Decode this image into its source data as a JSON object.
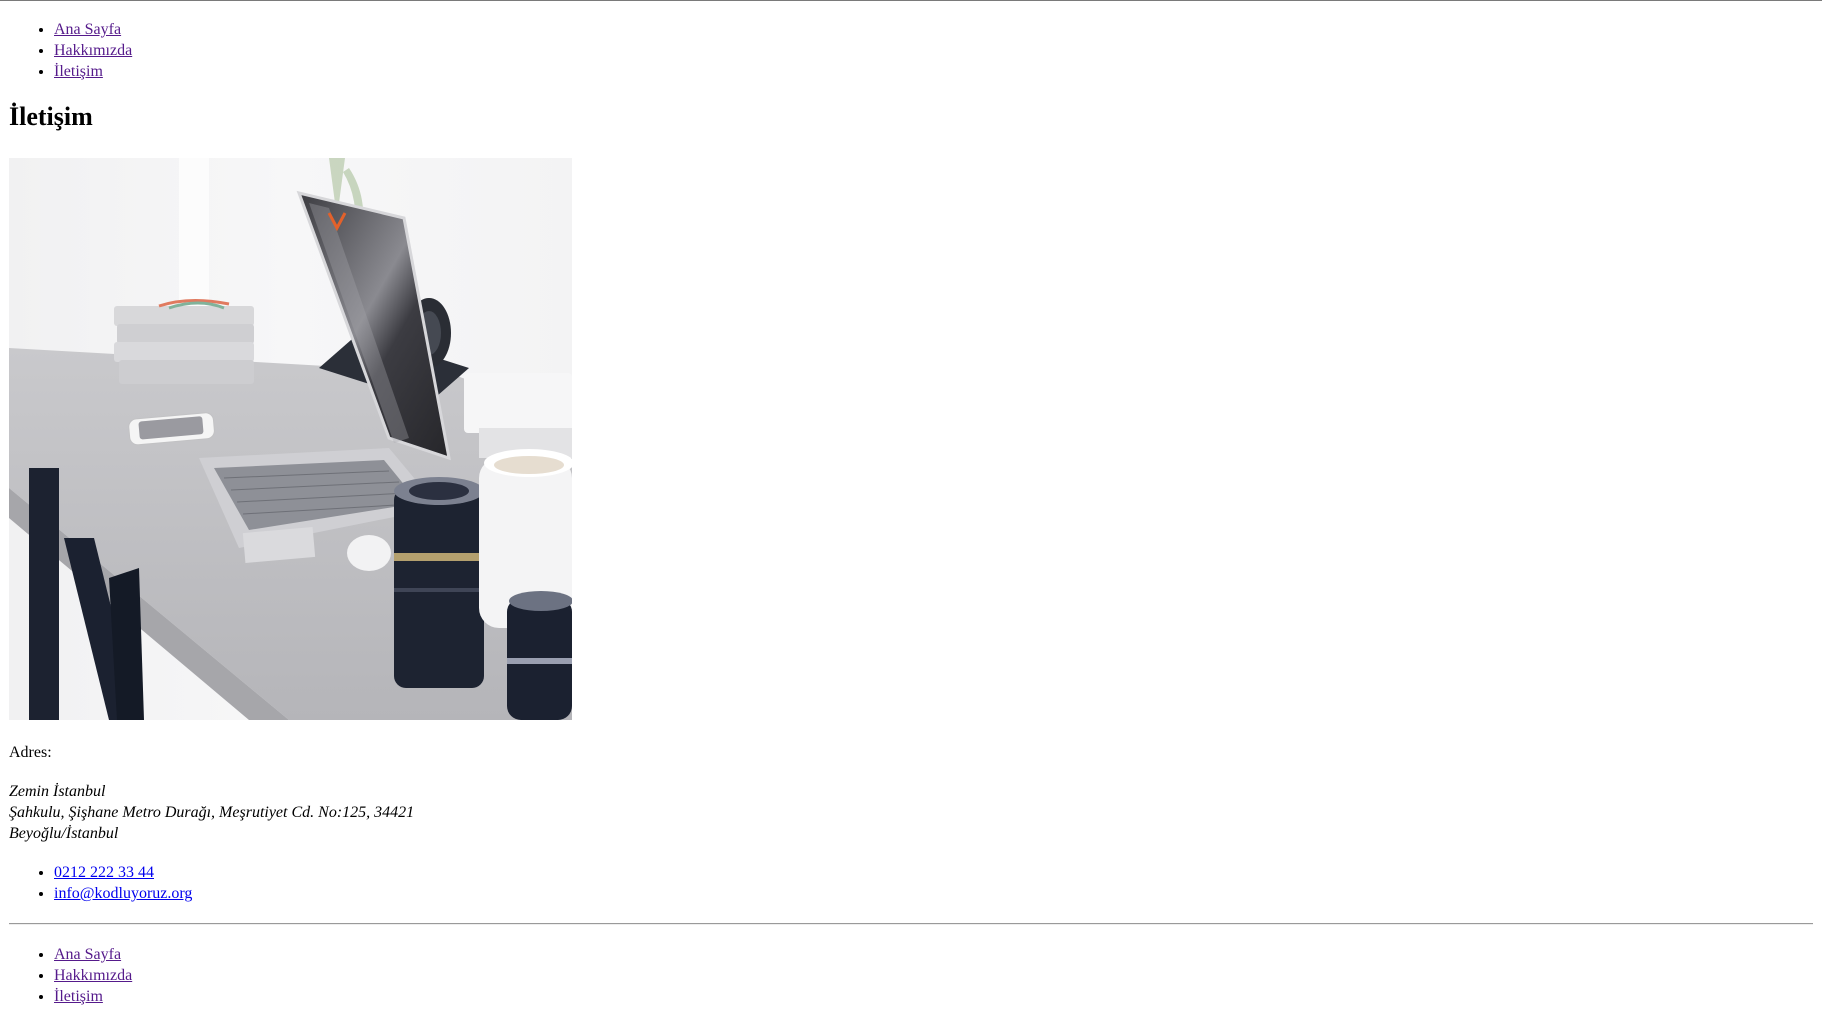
{
  "nav_top": {
    "items": [
      {
        "label": "Ana Sayfa"
      },
      {
        "label": "Hakkımızda"
      },
      {
        "label": "İletişim"
      }
    ]
  },
  "page": {
    "title": "İletişim"
  },
  "hero_image": {
    "subject": "laptop-on-desk-photo"
  },
  "contact": {
    "address_label": "Adres:",
    "address_lines": [
      "Zemin İstanbul",
      "Şahkulu, Şişhane Metro Durağı, Meşrutiyet Cd. No:125, 34421",
      "Beyoğlu/İstanbul"
    ],
    "phone": "0212 222 33 44",
    "email": "info@kodluyoruz.org"
  },
  "nav_bottom": {
    "items": [
      {
        "label": "Ana Sayfa"
      },
      {
        "label": "Hakkımızda"
      },
      {
        "label": "İletişim"
      }
    ]
  },
  "colors": {
    "visited_link": "#551a8b",
    "link": "#0000ee"
  }
}
